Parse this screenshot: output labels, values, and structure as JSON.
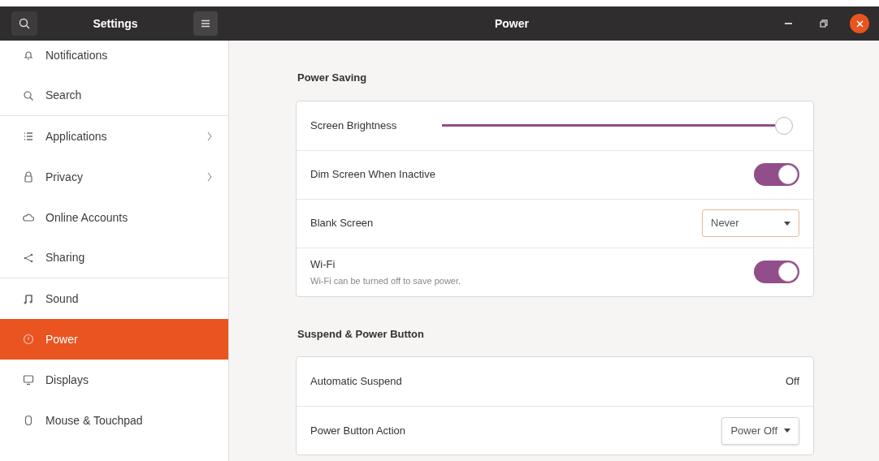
{
  "header": {
    "sidebar_title": "Settings",
    "title": "Power"
  },
  "sidebar": {
    "items": [
      {
        "label": "Notifications",
        "selected": false,
        "arrow": false,
        "divider": false
      },
      {
        "label": "Search",
        "selected": false,
        "arrow": false,
        "divider": true
      },
      {
        "label": "Applications",
        "selected": false,
        "arrow": true,
        "divider": false
      },
      {
        "label": "Privacy",
        "selected": false,
        "arrow": true,
        "divider": false
      },
      {
        "label": "Online Accounts",
        "selected": false,
        "arrow": false,
        "divider": false
      },
      {
        "label": "Sharing",
        "selected": false,
        "arrow": false,
        "divider": true
      },
      {
        "label": "Sound",
        "selected": false,
        "arrow": false,
        "divider": false
      },
      {
        "label": "Power",
        "selected": true,
        "arrow": false,
        "divider": false
      },
      {
        "label": "Displays",
        "selected": false,
        "arrow": false,
        "divider": false
      },
      {
        "label": "Mouse & Touchpad",
        "selected": false,
        "arrow": false,
        "divider": false
      }
    ]
  },
  "sections": [
    {
      "title": "Power Saving",
      "rows": [
        {
          "kind": "slider",
          "label": "Screen Brightness",
          "level": 0.98
        },
        {
          "kind": "switch",
          "label": "Dim Screen When Inactive",
          "on": true
        },
        {
          "kind": "dropdown",
          "label": "Blank Screen",
          "value": "Never",
          "focused": true
        },
        {
          "kind": "switch",
          "label": "Wi-Fi",
          "subtitle": "Wi-Fi can be turned off to save power.",
          "on": true
        }
      ]
    },
    {
      "title": "Suspend & Power Button",
      "rows": [
        {
          "kind": "value",
          "label": "Automatic Suspend",
          "value": "Off"
        },
        {
          "kind": "dropdown",
          "label": "Power Button Action",
          "value": "Power Off",
          "focused": false
        }
      ]
    }
  ]
}
